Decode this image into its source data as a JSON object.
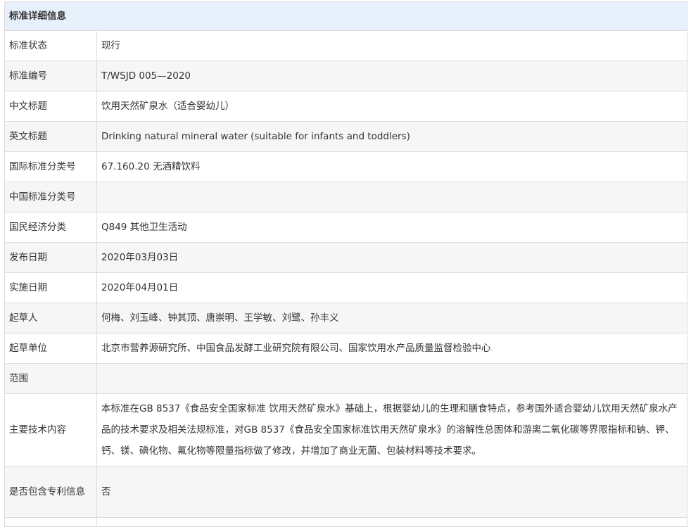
{
  "header": "标准详细信息",
  "rows": [
    {
      "label": "标准状态",
      "value": "现行"
    },
    {
      "label": "标准编号",
      "value": "T/WSJD 005—2020"
    },
    {
      "label": "中文标题",
      "value": "饮用天然矿泉水（适合婴幼儿）"
    },
    {
      "label": "英文标题",
      "value": "Drinking natural mineral water (suitable for infants and toddlers)"
    },
    {
      "label": "国际标准分类号",
      "value": "67.160.20 无酒精饮料"
    },
    {
      "label": "中国标准分类号",
      "value": ""
    },
    {
      "label": "国民经济分类",
      "value": "Q849 其他卫生活动"
    },
    {
      "label": "发布日期",
      "value": "2020年03月03日"
    },
    {
      "label": "实施日期",
      "value": "2020年04月01日"
    },
    {
      "label": "起草人",
      "value": "何梅、刘玉峰、钟其顶、唐崇明、王学敏、刘鹭、孙丰义"
    },
    {
      "label": "起草单位",
      "value": "北京市营养源研究所、中国食品发酵工业研究院有限公司、国家饮用水产品质量监督检验中心"
    },
    {
      "label": "范围",
      "value": ""
    },
    {
      "label": "主要技术内容",
      "value": "本标准在GB 8537《食品安全国家标准 饮用天然矿泉水》基础上，根据婴幼儿的生理和膳食特点，参考国外适合婴幼儿饮用天然矿泉水产品的技术要求及相关法规标准，对GB 8537《食品安全国家标准饮用天然矿泉水》的溶解性总固体和游离二氧化碳等界限指标和钠、钾、钙、镁、碘化物、氟化物等限量指标做了修改，并增加了商业无菌、包装材料等技术要求。"
    },
    {
      "label": "是否包含专利信息",
      "value": "否"
    }
  ]
}
